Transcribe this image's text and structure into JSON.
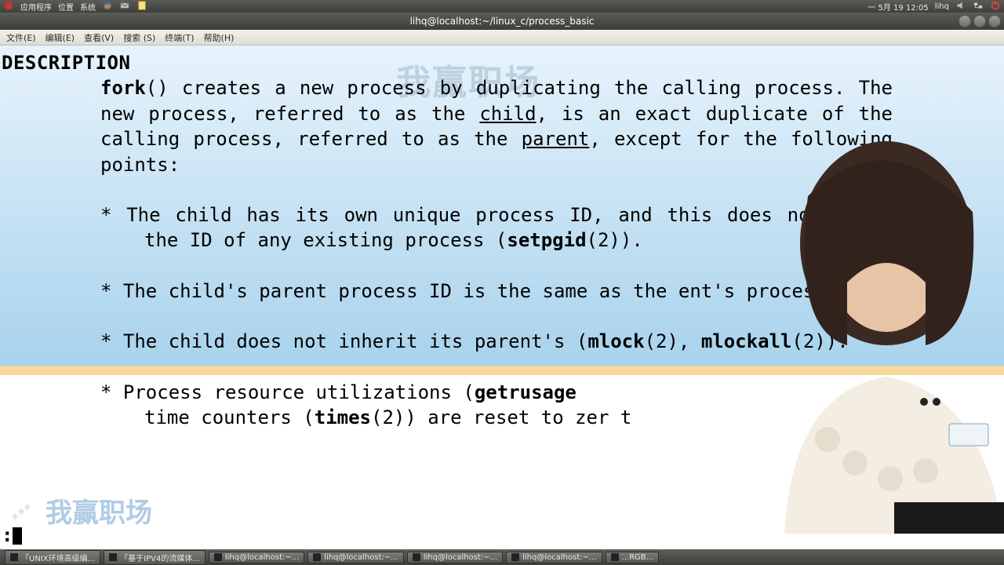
{
  "panel": {
    "apps_label": "应用程序",
    "places_label": "位置",
    "system_label": "系统",
    "clock": "一 5月 19 12:05",
    "user": "lihq"
  },
  "window": {
    "title": "lihq@localhost:~/linux_c/process_basic"
  },
  "menubar": {
    "file": "文件(E)",
    "edit": "编辑(E)",
    "view": "查看(V)",
    "search": "搜索 (S)",
    "terminal": "终端(T)",
    "help": "帮助(H)"
  },
  "manpage": {
    "section_heading": "DESCRIPTION",
    "intro_1": "fork",
    "intro_2": "()  creates  a  new  process by duplicating the calling process.  The new process, referred to as the ",
    "intro_child": "child",
    "intro_3": ", is  an exact  duplicate of the calling process, referred to as the ",
    "intro_parent": "parent",
    "intro_4": ", except for the following points:",
    "b1a": "*  The child has its own unique process ID,  and  this  does  not  match  the  ID  of any existing process (",
    "b1b": "setpgid",
    "b1c": "(2)).",
    "b2": "*  The child's parent process ID is the same  as  the  ent's process ID.",
    "b3a": "*  The  child  does  not  inherit its parent's  (",
    "b3b": "mlock",
    "b3c": "(2), ",
    "b3d": "mlockall",
    "b3e": "(2)).",
    "b4a": "*  Process resource  utilizations  (",
    "b4b": "getrusage",
    "b4c": "  time counters (",
    "b4d": "times",
    "b4e": "(2)) are reset to zer   t"
  },
  "prompt": ":",
  "watermark_main": "我赢职场",
  "watermark_corner": "我赢职场",
  "taskbar": {
    "items": [
      "「UNIX环境高级编...",
      "「基于IPV4的流媒体...",
      "lihq@localhost:~...",
      "lihq@localhost:~...",
      "lihq@localhost:~...",
      "lihq@localhost:~...",
      "...RGB..."
    ]
  }
}
